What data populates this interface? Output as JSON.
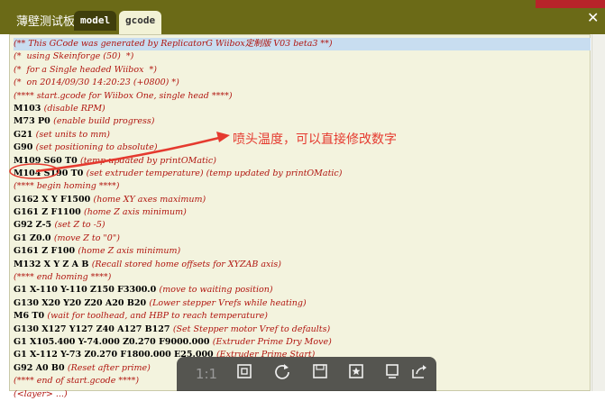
{
  "window": {
    "title": "薄壁测试板",
    "close_label": "✕",
    "watermark": ""
  },
  "tabs": [
    {
      "label": "model"
    },
    {
      "label": "gcode"
    }
  ],
  "code_lines": [
    [
      [
        "cm",
        "(** This GCode was generated by ReplicatorG Wiibox定制版 V03 beta3 **)"
      ]
    ],
    [
      [
        "cm",
        "(*  using Skeinforge (50)  *)"
      ]
    ],
    [
      [
        "cm",
        "(*  for a Single headed Wiibox  *)"
      ]
    ],
    [
      [
        "cm",
        "(*  on 2014/09/30 14:20:23 (+0800) *)"
      ]
    ],
    [
      [
        "cm",
        "(**** start.gcode for Wiibox One, single head ****)"
      ]
    ],
    [
      [
        "cmd",
        "M103 "
      ],
      [
        "cm",
        "(disable RPM)"
      ]
    ],
    [
      [
        "cmd",
        "M73 P0 "
      ],
      [
        "cm",
        "(enable build progress)"
      ]
    ],
    [
      [
        "cmd",
        "G21 "
      ],
      [
        "cm",
        "(set units to mm)"
      ]
    ],
    [
      [
        "cmd",
        "G90 "
      ],
      [
        "cm",
        "(set positioning to absolute)"
      ]
    ],
    [
      [
        "cmd",
        "M109 S60 T0 "
      ],
      [
        "cm",
        "(temp updated by printOMatic)"
      ]
    ],
    [
      [
        "cmd",
        "M104 S190 T0 "
      ],
      [
        "cm",
        "(set extruder temperature) (temp updated by printOMatic)"
      ]
    ],
    [
      [
        "cm",
        "(**** begin homing ****)"
      ]
    ],
    [
      [
        "cmd",
        "G162 X Y F1500 "
      ],
      [
        "cm",
        "(home XY axes maximum)"
      ]
    ],
    [
      [
        "cmd",
        "G161 Z F1100 "
      ],
      [
        "cm",
        "(home Z axis minimum)"
      ]
    ],
    [
      [
        "cmd",
        "G92 Z-5 "
      ],
      [
        "cm",
        "(set Z to -5)"
      ]
    ],
    [
      [
        "cmd",
        "G1 Z0.0 "
      ],
      [
        "cm",
        "(move Z to \"0\")"
      ]
    ],
    [
      [
        "cmd",
        "G161 Z F100 "
      ],
      [
        "cm",
        "(home Z axis minimum)"
      ]
    ],
    [
      [
        "cmd",
        "M132 X Y Z A B "
      ],
      [
        "cm",
        "(Recall stored home offsets for XYZAB axis)"
      ]
    ],
    [
      [
        "cm",
        "(**** end homing ****)"
      ]
    ],
    [
      [
        "cmd",
        "G1 X-110 Y-110 Z150 F3300.0 "
      ],
      [
        "cm",
        "(move to waiting position)"
      ]
    ],
    [
      [
        "cmd",
        "G130 X20 Y20 Z20 A20 B20 "
      ],
      [
        "cm",
        "(Lower stepper Vrefs while heating)"
      ]
    ],
    [
      [
        "cmd",
        "M6 T0 "
      ],
      [
        "cm",
        "(wait for toolhead, and HBP to reach temperature)"
      ]
    ],
    [
      [
        "cmd",
        "G130 X127 Y127 Z40 A127 B127 "
      ],
      [
        "cm",
        "(Set Stepper motor Vref to defaults)"
      ]
    ],
    [
      [
        "cmd",
        "G1 X105.400 Y-74.000 Z0.270 F9000.000 "
      ],
      [
        "cm",
        "(Extruder Prime Dry Move)"
      ]
    ],
    [
      [
        "cmd",
        "G1 X-112 Y-73 Z0.270 F1800.000 E25.000 "
      ],
      [
        "cm",
        "(Extruder Prime Start)"
      ]
    ],
    [
      [
        "cmd",
        "G92 A0 B0 "
      ],
      [
        "cm",
        "(Reset after prime)"
      ]
    ],
    [
      [
        "cm",
        "(**** end of start.gcode ****)"
      ]
    ],
    [
      [
        "cm",
        "(<layer> ...)"
      ]
    ]
  ],
  "annotation": {
    "text": "喷头温度，可以直接修改数字",
    "color": "#e53a2f"
  },
  "toolbar": {
    "ratio_label": "1:1",
    "icons": [
      "fit-screen-icon",
      "rotate-icon",
      "save-icon",
      "favorite-icon",
      "copy-icon",
      "share-icon"
    ]
  },
  "colors": {
    "titlebar": "#6b6a17",
    "editor_bg": "#f3f3de",
    "comment": "#b0150f",
    "highlight": "#c8ddf0"
  }
}
